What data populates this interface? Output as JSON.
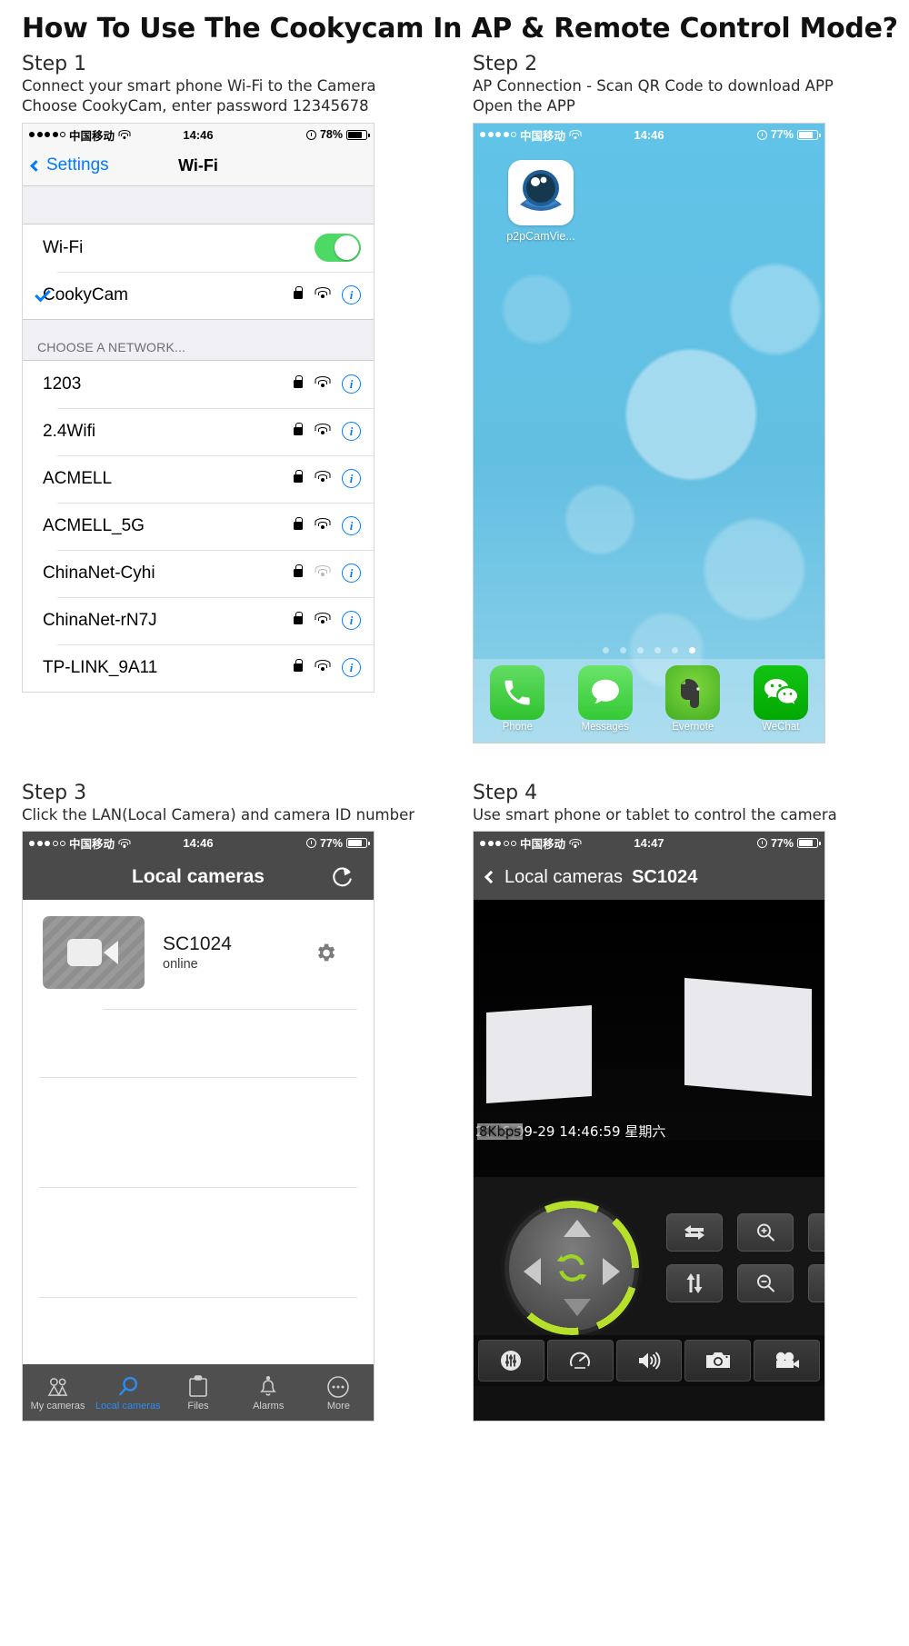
{
  "title": "How To Use The Cookycam In AP & Remote Control Mode?",
  "steps": [
    {
      "label": "Step 1",
      "desc": "Connect your smart phone Wi-Fi to the Camera\nChoose CookyCam, enter password 12345678"
    },
    {
      "label": "Step 2",
      "desc": "AP Connection - Scan QR Code to download APP\nOpen the APP"
    },
    {
      "label": "Step 3",
      "desc": "Click the LAN(Local Camera) and camera ID number"
    },
    {
      "label": "Step 4",
      "desc": "Use smart phone or tablet to control the camera"
    }
  ],
  "wifi_screen": {
    "status": {
      "carrier": "中国移动",
      "signal_dots": 5,
      "signal_filled": 4,
      "time": "14:46",
      "battery_percent": "78%",
      "battery_level": 78
    },
    "nav": {
      "back": "Settings",
      "title": "Wi-Fi"
    },
    "toggle_row": {
      "label": "Wi-Fi",
      "state": "on"
    },
    "connected": {
      "name": "CookyCam",
      "secured": true,
      "signal": "strong"
    },
    "section_header": "CHOOSE A NETWORK...",
    "networks": [
      {
        "name": "1203",
        "secured": true,
        "signal": "strong"
      },
      {
        "name": "2.4Wifi",
        "secured": true,
        "signal": "strong"
      },
      {
        "name": "ACMELL",
        "secured": true,
        "signal": "strong"
      },
      {
        "name": "ACMELL_5G",
        "secured": true,
        "signal": "strong"
      },
      {
        "name": "ChinaNet-Cyhi",
        "secured": true,
        "signal": "weak"
      },
      {
        "name": "ChinaNet-rN7J",
        "secured": true,
        "signal": "strong"
      },
      {
        "name": "TP-LINK_9A11",
        "secured": true,
        "signal": "strong"
      }
    ]
  },
  "home_screen": {
    "status": {
      "carrier": "中国移动",
      "signal_dots": 5,
      "signal_filled": 4,
      "time": "14:46",
      "battery_percent": "77%",
      "battery_level": 77
    },
    "app": {
      "label": "p2pCamVie...",
      "icon": "camera-eye-icon"
    },
    "page_dots": {
      "count": 6,
      "active_index": 5
    },
    "dock": [
      {
        "label": "Phone",
        "icon": "phone-icon",
        "color": "#3ecb3e"
      },
      {
        "label": "Messages",
        "icon": "message-bubble-icon",
        "color": "#4cd24c"
      },
      {
        "label": "Evernote",
        "icon": "elephant-icon",
        "color": "#5cc939"
      },
      {
        "label": "WeChat",
        "icon": "wechat-icon",
        "color": "#06b906"
      }
    ]
  },
  "cameras_screen": {
    "status": {
      "carrier": "中国移动",
      "signal_dots": 5,
      "signal_filled": 3,
      "time": "14:46",
      "battery_percent": "77%",
      "battery_level": 77
    },
    "nav": {
      "title": "Local cameras",
      "refresh": "refresh-icon"
    },
    "camera": {
      "name": "SC1024",
      "status": "online",
      "settings": "gear-icon"
    },
    "tabs": [
      {
        "label": "My cameras",
        "icon": "people-icon",
        "active": false
      },
      {
        "label": "Local cameras",
        "icon": "magnifier-icon",
        "active": true
      },
      {
        "label": "Files",
        "icon": "clipboard-icon",
        "active": false
      },
      {
        "label": "Alarms",
        "icon": "bell-icon",
        "active": false
      },
      {
        "label": "More",
        "icon": "ellipsis-circle-icon",
        "active": false
      }
    ]
  },
  "live_screen": {
    "status": {
      "carrier": "中国移动",
      "signal_dots": 5,
      "signal_filled": 3,
      "time": "14:47",
      "battery_percent": "77%",
      "battery_level": 77
    },
    "nav": {
      "back": "Local cameras",
      "device": "SC1024"
    },
    "osd": {
      "bitrate": "8Kbps",
      "timestamp": "2016-09-29 14:46:59 星期六"
    },
    "dpad": {
      "up": "arrow-up",
      "down": "arrow-down",
      "left": "arrow-left",
      "right": "arrow-right",
      "center": "rotate-preset-icon"
    },
    "function_buttons": [
      {
        "name": "horizontal-patrol-icon"
      },
      {
        "name": "zoom-in-icon"
      },
      {
        "name": "flip-horizontal-icon"
      },
      {
        "name": "vertical-patrol-icon"
      },
      {
        "name": "zoom-out-icon"
      },
      {
        "name": "mirror-icon"
      }
    ],
    "toolbar_buttons": [
      {
        "name": "settings-sliders-icon"
      },
      {
        "name": "speed-gauge-icon"
      },
      {
        "name": "speaker-icon"
      },
      {
        "name": "snapshot-camera-icon"
      },
      {
        "name": "record-video-icon"
      }
    ]
  }
}
